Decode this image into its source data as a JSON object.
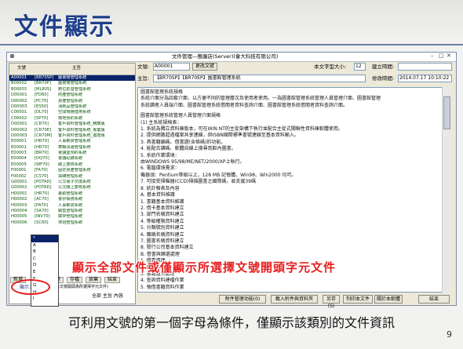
{
  "slide": {
    "title": "文件顯示",
    "caption": "可利用文號的第一個字母為條件，僅顯示該類別的文件資訊",
    "page": "9",
    "overlay": "顯示全部文件或僅顯示所選擇文號開頭字元文件"
  },
  "window": {
    "title": "文件管理—應廉店(Server)(會大科技有限公司)"
  },
  "list": {
    "col_no": "文號",
    "col_title": "主旨",
    "rows": [
      {
        "no": "A00001",
        "code": "[BR70SP]",
        "title": "圖書館管理系統"
      },
      {
        "no": "B00002",
        "code": "[BR70P]",
        "title": "圖書館管理系統"
      },
      {
        "no": "B00003",
        "code": "[ML80S]",
        "title": "數位影音管理系統"
      },
      {
        "no": "D00001",
        "code": "[FD60]",
        "title": "財產管理系統"
      },
      {
        "no": "D00002",
        "code": "[PC70]",
        "title": "資產管理系統"
      },
      {
        "no": "D00003",
        "code": "[ES50]",
        "title": "消耗品管理系統"
      },
      {
        "no": "C00001",
        "code": "[DL70]",
        "title": "空間場館借用系統"
      },
      {
        "no": "C00002",
        "code": "[SP70]",
        "title": "場地預約系統"
      },
      {
        "no": "D00001",
        "code": "[CR70]",
        "title": "客戶資料管理系統_精簡版"
      },
      {
        "no": "D00002",
        "code": "[CR70E]",
        "title": "客戶資料管理系統_專業版"
      },
      {
        "no": "D00003",
        "code": "[CR70M]",
        "title": "客戶資料管理系統_進階版"
      },
      {
        "no": "E00001",
        "code": "[HR70]",
        "title": "人事薪資管理系統"
      },
      {
        "no": "E00002",
        "code": "[HR70]",
        "title": "車輛派遣管理系統"
      },
      {
        "no": "E00003",
        "code": "[BR70]",
        "title": "會議室預約系統"
      },
      {
        "no": "E00004",
        "code": "[DQ70]",
        "title": "會議紀錄系統"
      },
      {
        "no": "E00005",
        "code": "[WF70]",
        "title": "線上簽核系統"
      },
      {
        "no": "F00001",
        "code": "[FA70]",
        "title": "固定資產管理系統"
      },
      {
        "no": "F00002",
        "code": "[CS70]",
        "title": "採購管理系統"
      },
      {
        "no": "G00001",
        "code": "[POTAD]",
        "title": "公文電子交換系統"
      },
      {
        "no": "G00002",
        "code": "[POTAD]",
        "title": "公文線上簽核系統"
      },
      {
        "no": "H00001",
        "code": "[HR70]",
        "title": "差勤管理系統"
      },
      {
        "no": "H00002",
        "code": "[AC70]",
        "title": "會計帳務系統"
      },
      {
        "no": "H00003",
        "code": "[PA70]",
        "title": "人事薪資系統"
      },
      {
        "no": "H00004",
        "code": "[SA70]",
        "title": "銷售管理系統"
      },
      {
        "no": "H00005",
        "code": "[INV70]",
        "title": "庫存管理系統"
      },
      {
        "no": "H00006",
        "code": "[SC60]",
        "title": "排班管理系統"
      }
    ],
    "dropdown": [
      "*",
      "A",
      "B",
      "C",
      "D",
      "E",
      "F",
      "G",
      "H",
      "I"
    ],
    "buttons": [
      "新增",
      "修改",
      "刪除",
      "存檔",
      "放棄",
      "結束"
    ],
    "show_label": "顯示：",
    "show_value": "*",
    "show_hint": "(僅顯示文號開頭為所選擇字元文件)",
    "sort_label": "全部 主旨 內容"
  },
  "form": {
    "no_label": "文號:",
    "no_value": "A00001",
    "rename_btn": "更改文號",
    "fontsize_label": "本文字型大小:",
    "fontsize_value": "12",
    "created_label": "建立時間:",
    "created_value": "",
    "subject_label": "主旨:",
    "subject_value": "【BR70SP】【BR70EP】圖書館管理系統",
    "modified_label": "修改時間:",
    "modified_value": "2014.07.17 10:10:22"
  },
  "content": [
    "圖書館管理系統規格",
    "系統介面分為四套介面，以方便不同的管理層次及使用者使用。一為圖書館管理系統管理人員管理介面、圖書館管理",
    "系統讀者人員端介面、圖書館管理系統借閱者資料查詢介面、圖書館管理系統借閱者資料查詢介面。",
    "",
    "圖書館管理系統管理人員管理介面規格",
    "(1) 主系統規格表：",
    "1. 系統為獨立資料庫版本，可在WIN NT的主從架構下執行並配合主從式關聯性資料庫軟體使用。",
    "2. 提供網路超過檔案共享連線，供ISBN國際標準書號連線至基本資料輸入。",
    "3. 具書籍編碼、借書證(含條碼)的功能。",
    "4. 能配合讀碼、軟體自線上搜尋到館內圖書。",
    "5. 系統作業環境：",
    "   由WINDOWS 95/98/ME/NET/2000/XP上執行。",
    "6. 電腦環境需求：",
    "   機器須：Pentium等級以上，128 MB 記憶體，Win98、Win2000 均可。",
    "7. 可接受掃瞄器(CCD)掃描圖書之國際碼，並支援39碼",
    "8. 統計報表及內容",
    "A. 基本資料維護",
    "1. 書籍基本資料維護",
    "2. 借卡基本資料建立",
    "3. 部門名稱資料建立",
    "4. 等級權限資料建立",
    "5. 分類號別資料建立",
    "6. 職稱名稱資料建立",
    "7. 圖書名稱資料建立",
    "8. 發行公司基本資料建立",
    "B. 借書與歸還處理",
    "1. 借書處理",
    "2. 歸還處理",
    "3. 書籍遺失處理",
    "4. 查詢資料建檔作業",
    "5. 預借書籍資料作業"
  ],
  "bottom": {
    "b1": "附件管理功能(0)",
    "b2": "載入附件與資料夾",
    "b3": "另存(S)",
    "b4": "列印本文件",
    "b5": "關於本軟體",
    "b6": "結束"
  }
}
